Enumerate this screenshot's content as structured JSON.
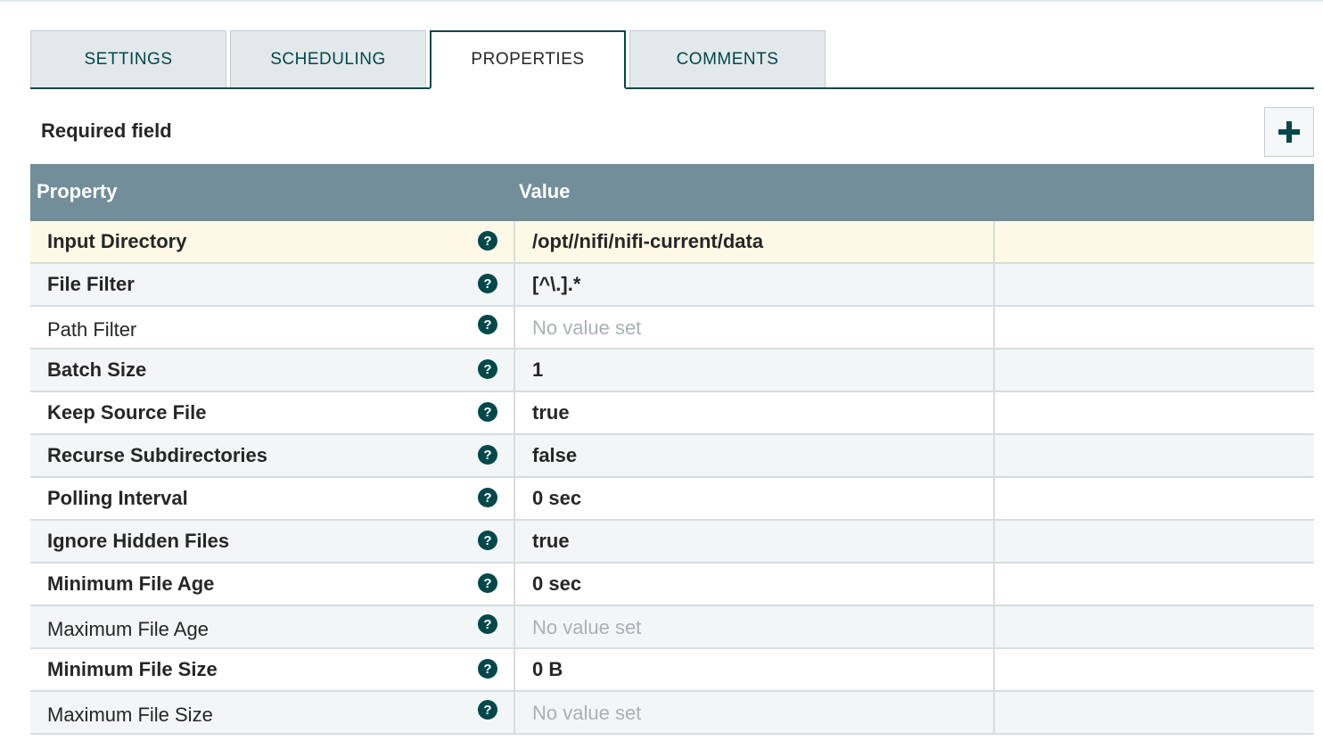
{
  "tabs": [
    {
      "label": "SETTINGS"
    },
    {
      "label": "SCHEDULING"
    },
    {
      "label": "PROPERTIES"
    },
    {
      "label": "COMMENTS"
    }
  ],
  "active_tab": "PROPERTIES",
  "required_label": "Required field",
  "add_icon": "plus-icon",
  "table": {
    "columns": [
      "Property",
      "Value"
    ],
    "rows": [
      {
        "name": "Input Directory",
        "value": "/opt//nifi/nifi-current/data",
        "required": true
      },
      {
        "name": "File Filter",
        "value": "[^\\.].*",
        "required": true
      },
      {
        "name": "Path Filter",
        "value": "No value set",
        "required": false
      },
      {
        "name": "Batch Size",
        "value": "1",
        "required": true
      },
      {
        "name": "Keep Source File",
        "value": "true",
        "required": true
      },
      {
        "name": "Recurse Subdirectories",
        "value": "false",
        "required": true
      },
      {
        "name": "Polling Interval",
        "value": "0 sec",
        "required": true
      },
      {
        "name": "Ignore Hidden Files",
        "value": "true",
        "required": true
      },
      {
        "name": "Minimum File Age",
        "value": "0 sec",
        "required": true
      },
      {
        "name": "Maximum File Age",
        "value": "No value set",
        "required": false
      },
      {
        "name": "Minimum File Size",
        "value": "0 B",
        "required": true
      },
      {
        "name": "Maximum File Size",
        "value": "No value set",
        "required": false
      }
    ]
  },
  "help_icon": "question-circle-icon",
  "colors": {
    "accent": "#004849",
    "header_bg": "#728e9b",
    "selected_row_bg": "#fdf9e6",
    "alt_row_bg": "#f3f6f6",
    "placeholder_text": "#a9b1b5"
  }
}
